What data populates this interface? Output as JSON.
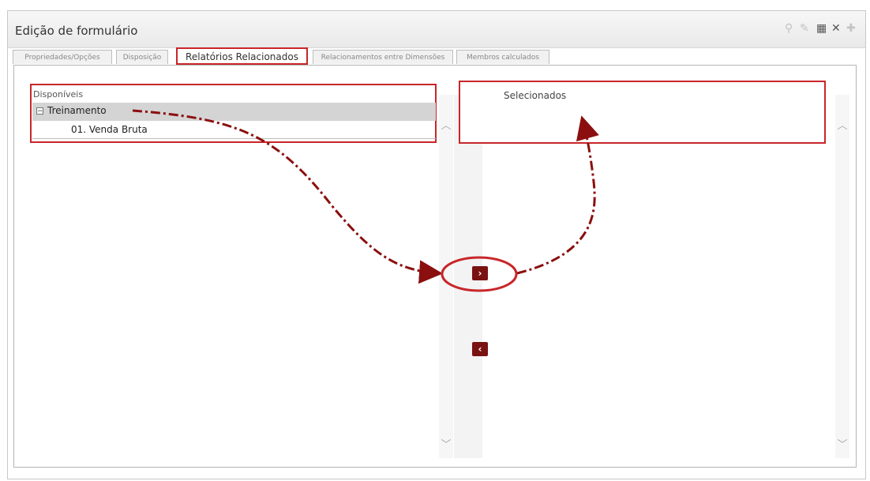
{
  "window": {
    "title": "Edição de formulário",
    "controls": [
      {
        "icon": "search-icon",
        "glyph": "⚲"
      },
      {
        "icon": "edit-icon",
        "glyph": "✎"
      },
      {
        "icon": "save-icon",
        "glyph": "▦"
      },
      {
        "icon": "close-icon",
        "glyph": "✕"
      },
      {
        "icon": "pin-icon",
        "glyph": "✚"
      }
    ]
  },
  "tabs": [
    {
      "label": "Propriedades/Opções"
    },
    {
      "label": "Disposição"
    },
    {
      "label": "Relatórios Relacionados",
      "active": true
    },
    {
      "label": "Relacionamentos entre Dimensões"
    },
    {
      "label": "Membros calculados"
    }
  ],
  "available": {
    "label": "Disponíveis",
    "group": {
      "toggle": "−",
      "label": "Treinamento"
    },
    "items": [
      {
        "label": "01. Venda Bruta"
      }
    ]
  },
  "selected": {
    "label": "Selecionados"
  },
  "buttons": {
    "add": "›",
    "remove": "‹"
  },
  "scroll": {
    "up": "︿",
    "down": "﹀"
  },
  "colors": {
    "highlight": "#c8262a",
    "arrow": "#8b0f0f",
    "button": "#7a1212"
  }
}
